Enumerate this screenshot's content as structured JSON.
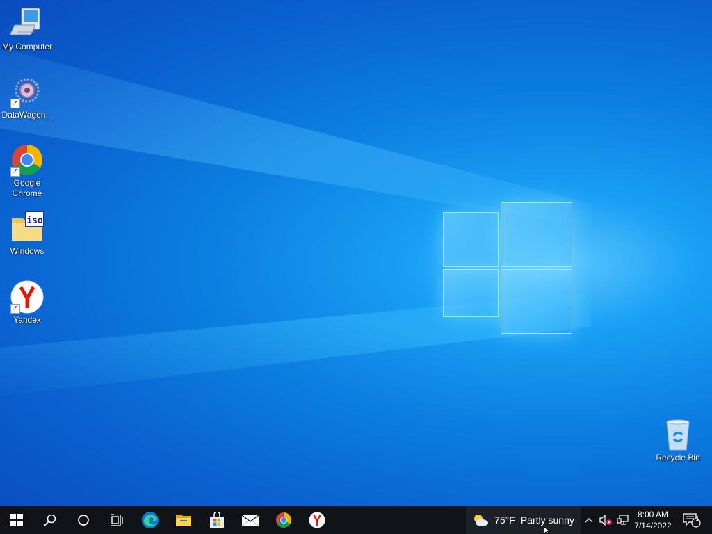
{
  "desktop": {
    "icons": [
      {
        "label": "My Computer",
        "icon": "computer-icon",
        "shortcut": false
      },
      {
        "label": "DataWagon...",
        "icon": "datawagon-icon",
        "shortcut": true
      },
      {
        "label": "Google Chrome",
        "icon": "chrome-icon",
        "shortcut": true
      },
      {
        "label": "Windows",
        "icon": "iso-folder-icon",
        "iso_text": "iso",
        "shortcut": false
      },
      {
        "label": "Yandex",
        "icon": "yandex-icon",
        "shortcut": true
      },
      {
        "label": "Recycle Bin",
        "icon": "recycle-bin-icon",
        "shortcut": false
      }
    ]
  },
  "taskbar": {
    "buttons": [
      "start-icon",
      "search-icon",
      "cortana-icon",
      "task-view-icon",
      "edge-icon",
      "file-explorer-icon",
      "microsoft-store-icon",
      "mail-icon",
      "chrome-icon",
      "yandex-icon"
    ],
    "weather": {
      "temperature": "75°F",
      "condition": "Partly sunny"
    },
    "clock": {
      "time": "8:00 AM",
      "date": "7/14/2022"
    },
    "notifications": {
      "count": "1"
    }
  },
  "colors": {
    "taskbar": "#101418",
    "accent": "#0078d7"
  }
}
